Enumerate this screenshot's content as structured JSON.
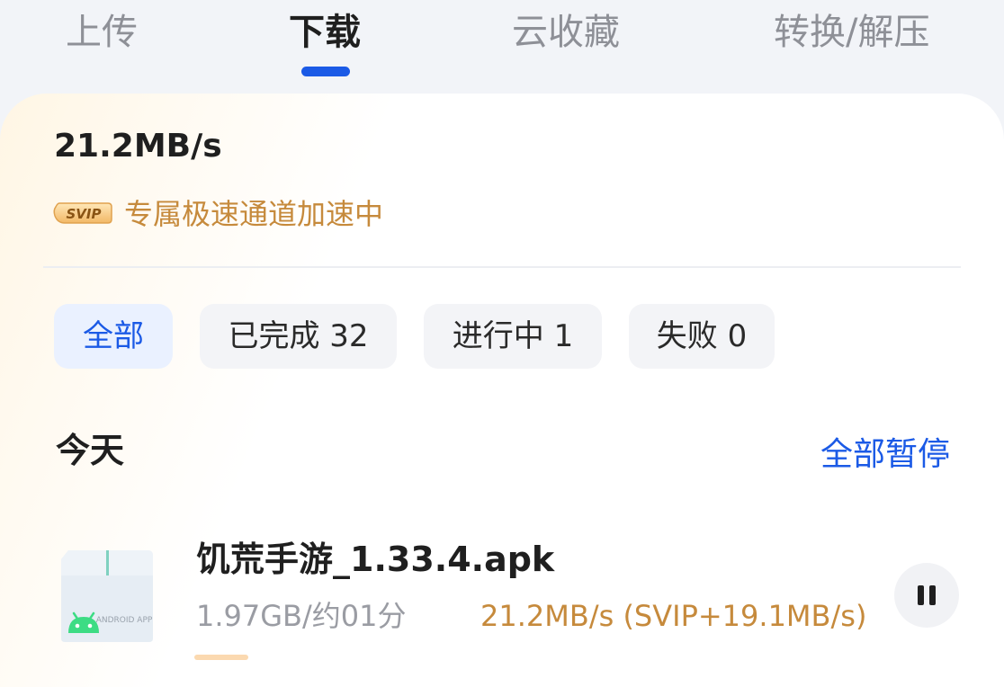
{
  "tabs": [
    {
      "label": "上传"
    },
    {
      "label": "下载"
    },
    {
      "label": "云收藏"
    },
    {
      "label": "转换/解压"
    }
  ],
  "active_tab": "下载",
  "summary": {
    "speed": "21.2MB/s",
    "svip_badge": "SVIP",
    "accel_text": "专属极速通道加速中"
  },
  "filters": [
    {
      "label": "全部"
    },
    {
      "label": "已完成 32"
    },
    {
      "label": "进行中 1"
    },
    {
      "label": "失败 0"
    }
  ],
  "active_filter": "全部",
  "section": {
    "title": "今天",
    "pause_all": "全部暂停"
  },
  "downloads": [
    {
      "name": "饥荒手游_1.33.4.apk",
      "size_eta": "1.97GB/约01分",
      "speed": "21.2MB/s (SVIP+19.1MB/s)",
      "icon_text": "ANDROID APP",
      "icon": "android-apk-icon",
      "action_icon": "pause-icon"
    }
  ],
  "colors": {
    "accent": "#1b5ae6",
    "svip_gold": "#c68a3c",
    "android_green": "#3ddc84"
  }
}
